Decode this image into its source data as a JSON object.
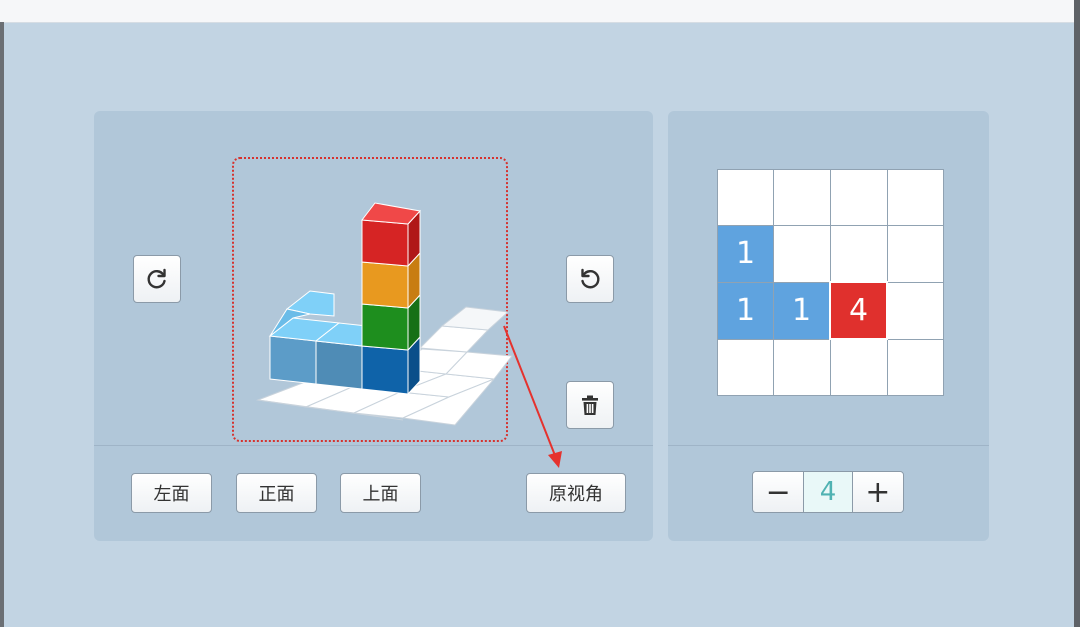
{
  "left_panel": {
    "rotate_cw_icon": "rotate-clockwise-icon",
    "rotate_ccw_icon": "rotate-counterclockwise-icon",
    "delete_icon": "trash-icon",
    "view_buttons": {
      "left": "左面",
      "front": "正面",
      "top": "上面",
      "original": "原视角"
    }
  },
  "right_panel": {
    "grid": [
      [
        "",
        "",
        "",
        ""
      ],
      [
        "1",
        "",
        "",
        ""
      ],
      [
        "1",
        "1",
        "4",
        ""
      ],
      [
        "",
        "",
        "",
        ""
      ]
    ],
    "stepper": {
      "minus": "−",
      "value": "4",
      "plus": "+"
    }
  },
  "colors": {
    "background": "#c2d4e3",
    "panel": "#b1c7d9",
    "highlight_blue": "#5fa3df",
    "highlight_red": "#e0302d",
    "frame_red": "#d6322e"
  }
}
